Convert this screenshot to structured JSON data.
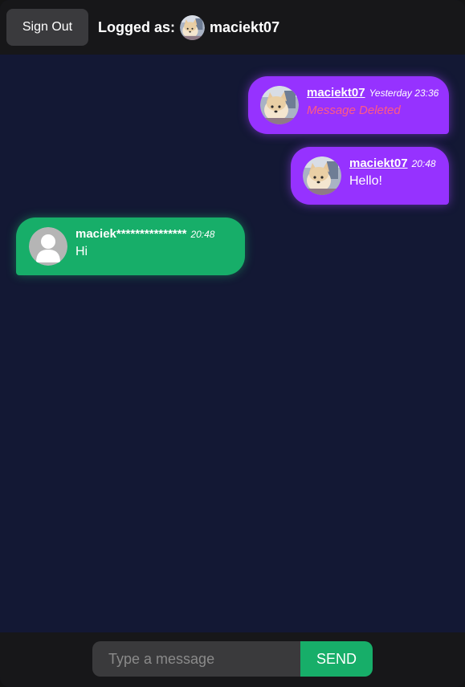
{
  "header": {
    "sign_out_label": "Sign Out",
    "logged_as_label": "Logged as:",
    "username": "maciekt07",
    "avatar_icon": "user-photo-shiba-icon"
  },
  "messages": [
    {
      "side": "right",
      "username": "maciekt07",
      "time": "Yesterday 23:36",
      "text": "Message Deleted",
      "deleted": true,
      "avatar": "user-photo-shiba-icon"
    },
    {
      "side": "right",
      "username": "maciekt07",
      "time": "20:48",
      "text": "Hello!",
      "deleted": false,
      "avatar": "user-photo-shiba-icon"
    },
    {
      "side": "left",
      "username": "maciek***************",
      "time": "20:48",
      "text": "Hi",
      "deleted": false,
      "avatar": "default-user-icon"
    }
  ],
  "composer": {
    "placeholder": "Type a message",
    "value": "",
    "send_label": "SEND"
  },
  "colors": {
    "background": "#131834",
    "bar": "#171719",
    "own_bubble": "#9632ff",
    "other_bubble": "#17ae69",
    "deleted_text": "#ff5a84"
  }
}
